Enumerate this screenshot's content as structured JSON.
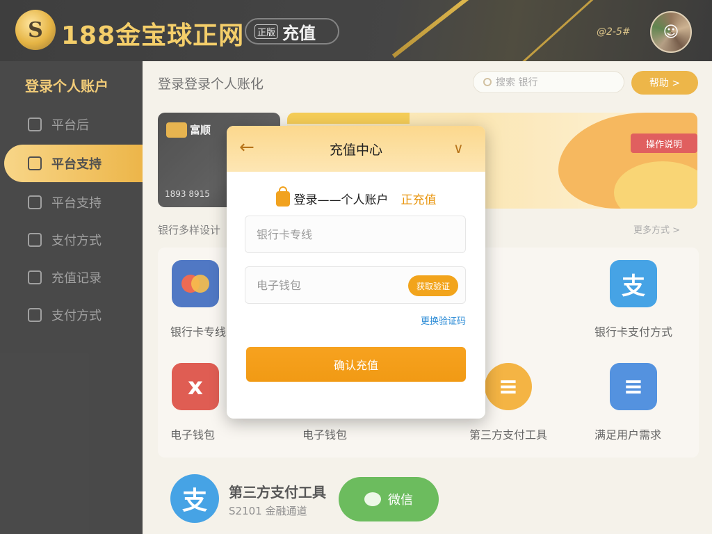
{
  "header": {
    "logo_glyph": "S",
    "brand": "188金宝球正网",
    "recharge_tag": "正版",
    "recharge_label": "充值",
    "user_code": "@2-5#",
    "avatar_icon": "user-avatar-icon"
  },
  "sidebar": {
    "title": "登录个人账户",
    "items": [
      {
        "label": "平台后",
        "active": false
      },
      {
        "label": "平台支持",
        "active": true
      },
      {
        "label": "平台支持",
        "active": false
      },
      {
        "label": "支付方式",
        "active": false
      },
      {
        "label": "充值记录",
        "active": false
      },
      {
        "label": "支付方式",
        "active": false
      }
    ]
  },
  "main": {
    "page_title": "登录登录个人账化",
    "search_placeholder": "搜索 银行",
    "help_label": "帮助 >",
    "bank_card": {
      "name": "富顺",
      "number": "1893 8915"
    },
    "promo_tag": "操作说明",
    "section_label": "银行多样设计",
    "more_link": "更多方式 >",
    "tiles": [
      {
        "label": "银行卡专线",
        "icon_text": "●",
        "color": "#2a5bb8"
      },
      {
        "label": "银行卡支付方式",
        "icon_text": "支",
        "color": "#1e8fe0"
      },
      {
        "label": "电子钱包",
        "icon_text": "x",
        "color": "#d83a2e"
      },
      {
        "label": "电子钱包",
        "icon_text": "",
        "color": "#f3efe6"
      },
      {
        "label": "第三方支付工具",
        "icon_text": "≡",
        "color": "#f2a41c"
      },
      {
        "label": "满足用户需求",
        "icon_text": "≡",
        "color": "#2f7bd8"
      }
    ],
    "bottom": {
      "icon_text": "支",
      "title": "第三方支付工具",
      "subtitle": "S2101 金融通道",
      "wechat_label": "微信"
    }
  },
  "modal": {
    "back_icon": "←",
    "title": "充值中心",
    "collapse_icon": "∨",
    "subtitle": "登录——个人账户",
    "subtitle_accent": "正充值",
    "field1_placeholder": "银行卡专线",
    "field2_placeholder": "电子钱包",
    "code_button": "获取验证",
    "link": "更换验证码",
    "confirm_label": "确认充值"
  }
}
